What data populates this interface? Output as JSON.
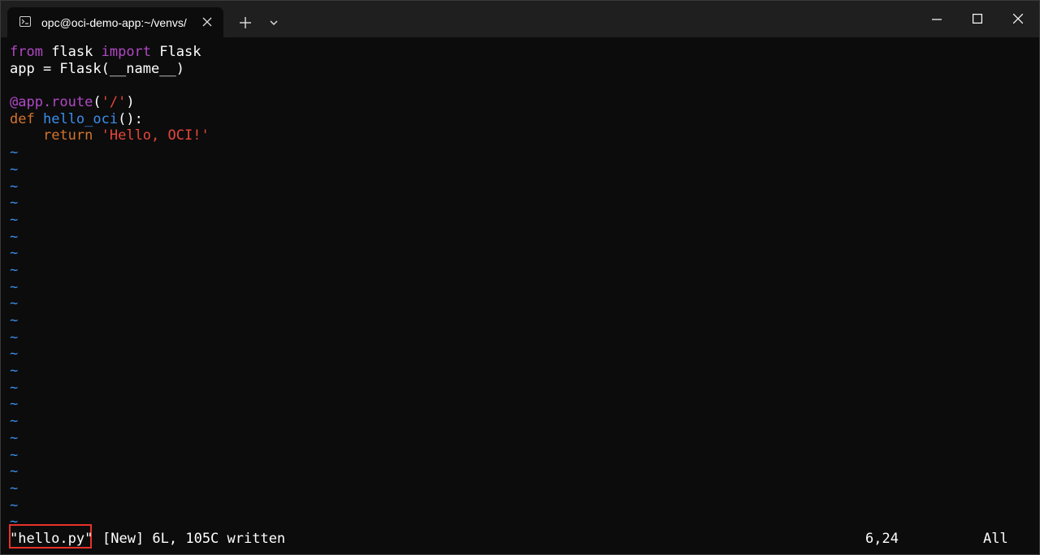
{
  "tab": {
    "title": "opc@oci-demo-app:~/venvs/",
    "icon": "terminal-icon"
  },
  "window_controls": {
    "minimize_icon": "minimize-icon",
    "maximize_icon": "maximize-icon",
    "close_icon": "close-icon"
  },
  "code": {
    "line1": {
      "kw_from": "from",
      "module": " flask ",
      "kw_import": "import",
      "name": " Flask"
    },
    "line2": {
      "text": "app = Flask(__name__)"
    },
    "line4": {
      "decorator": "@app.route",
      "open": "(",
      "arg": "'/'",
      "close": ")"
    },
    "line5": {
      "kw_def": "def",
      "space": " ",
      "fn": "hello_oci",
      "rest": "():"
    },
    "line6": {
      "indent": "    ",
      "kw_return": "return",
      "space": " ",
      "str": "'Hello, OCI!'"
    }
  },
  "tilde_char": "~",
  "status": {
    "file": "\"hello.py\"",
    "message": "[New] 6L, 105C written",
    "position": "6,24",
    "scroll": "All"
  },
  "colors": {
    "background": "#0c0c0c",
    "keyword_purple": "#b148c6",
    "keyword_orange": "#d4742f",
    "function_blue": "#3b8eea",
    "string_red": "#e8463a",
    "highlight_box": "#e8322a"
  }
}
